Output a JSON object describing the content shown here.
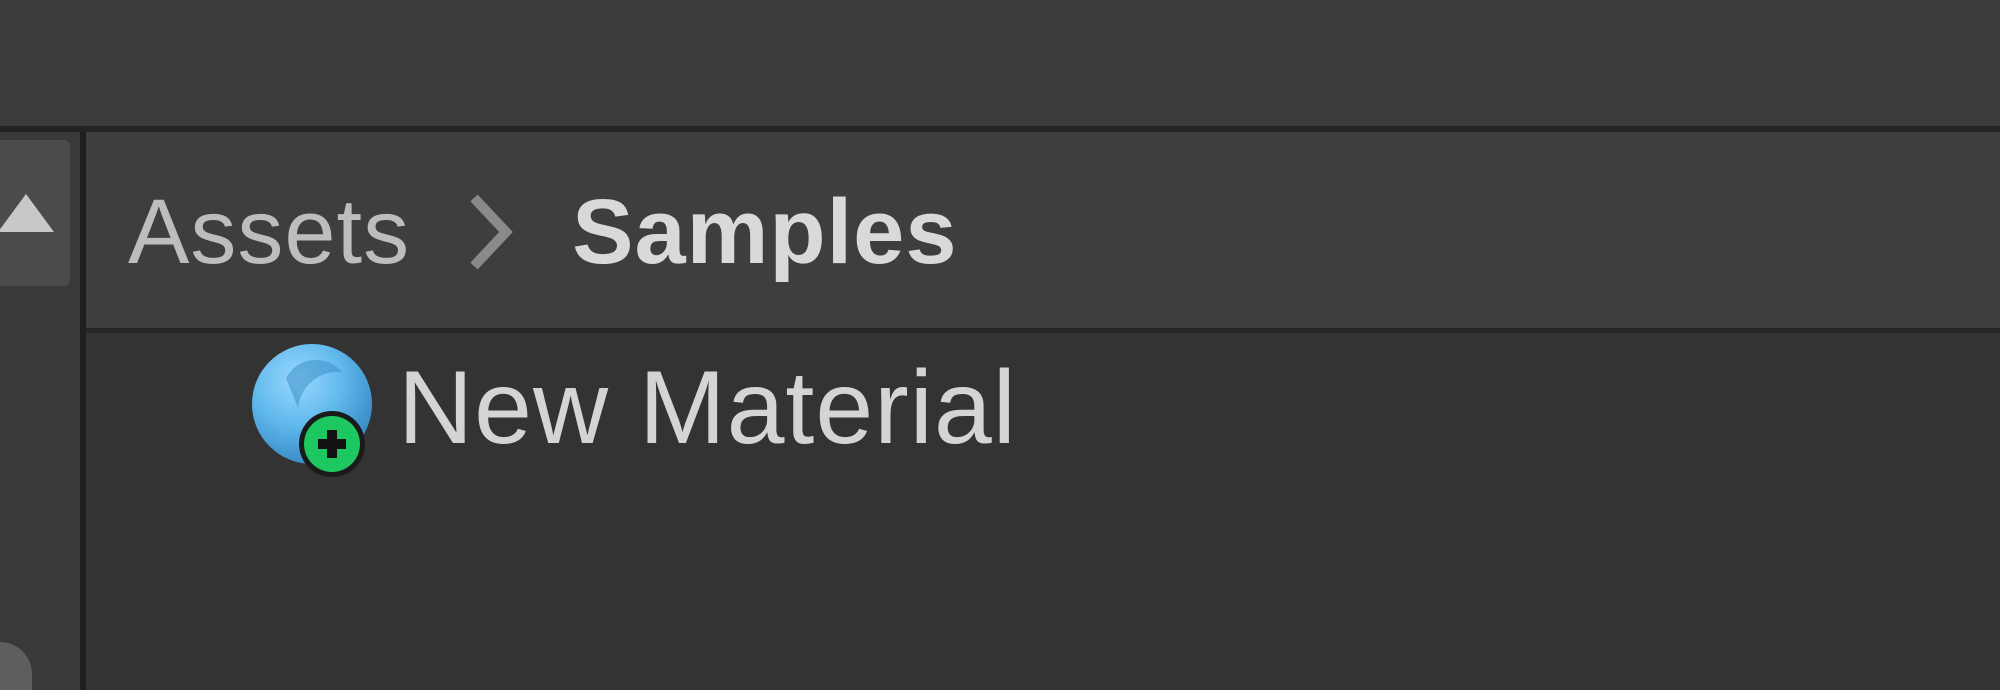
{
  "breadcrumb": {
    "items": [
      {
        "label": "Assets"
      },
      {
        "label": "Samples"
      }
    ]
  },
  "assets": [
    {
      "label": "New Material",
      "icon": "material-new-icon"
    }
  ],
  "colors": {
    "panel_bg": "#3c3c3c",
    "content_bg": "#333333",
    "material_blue": "#5fb8ec",
    "add_badge_green": "#1ec860"
  }
}
